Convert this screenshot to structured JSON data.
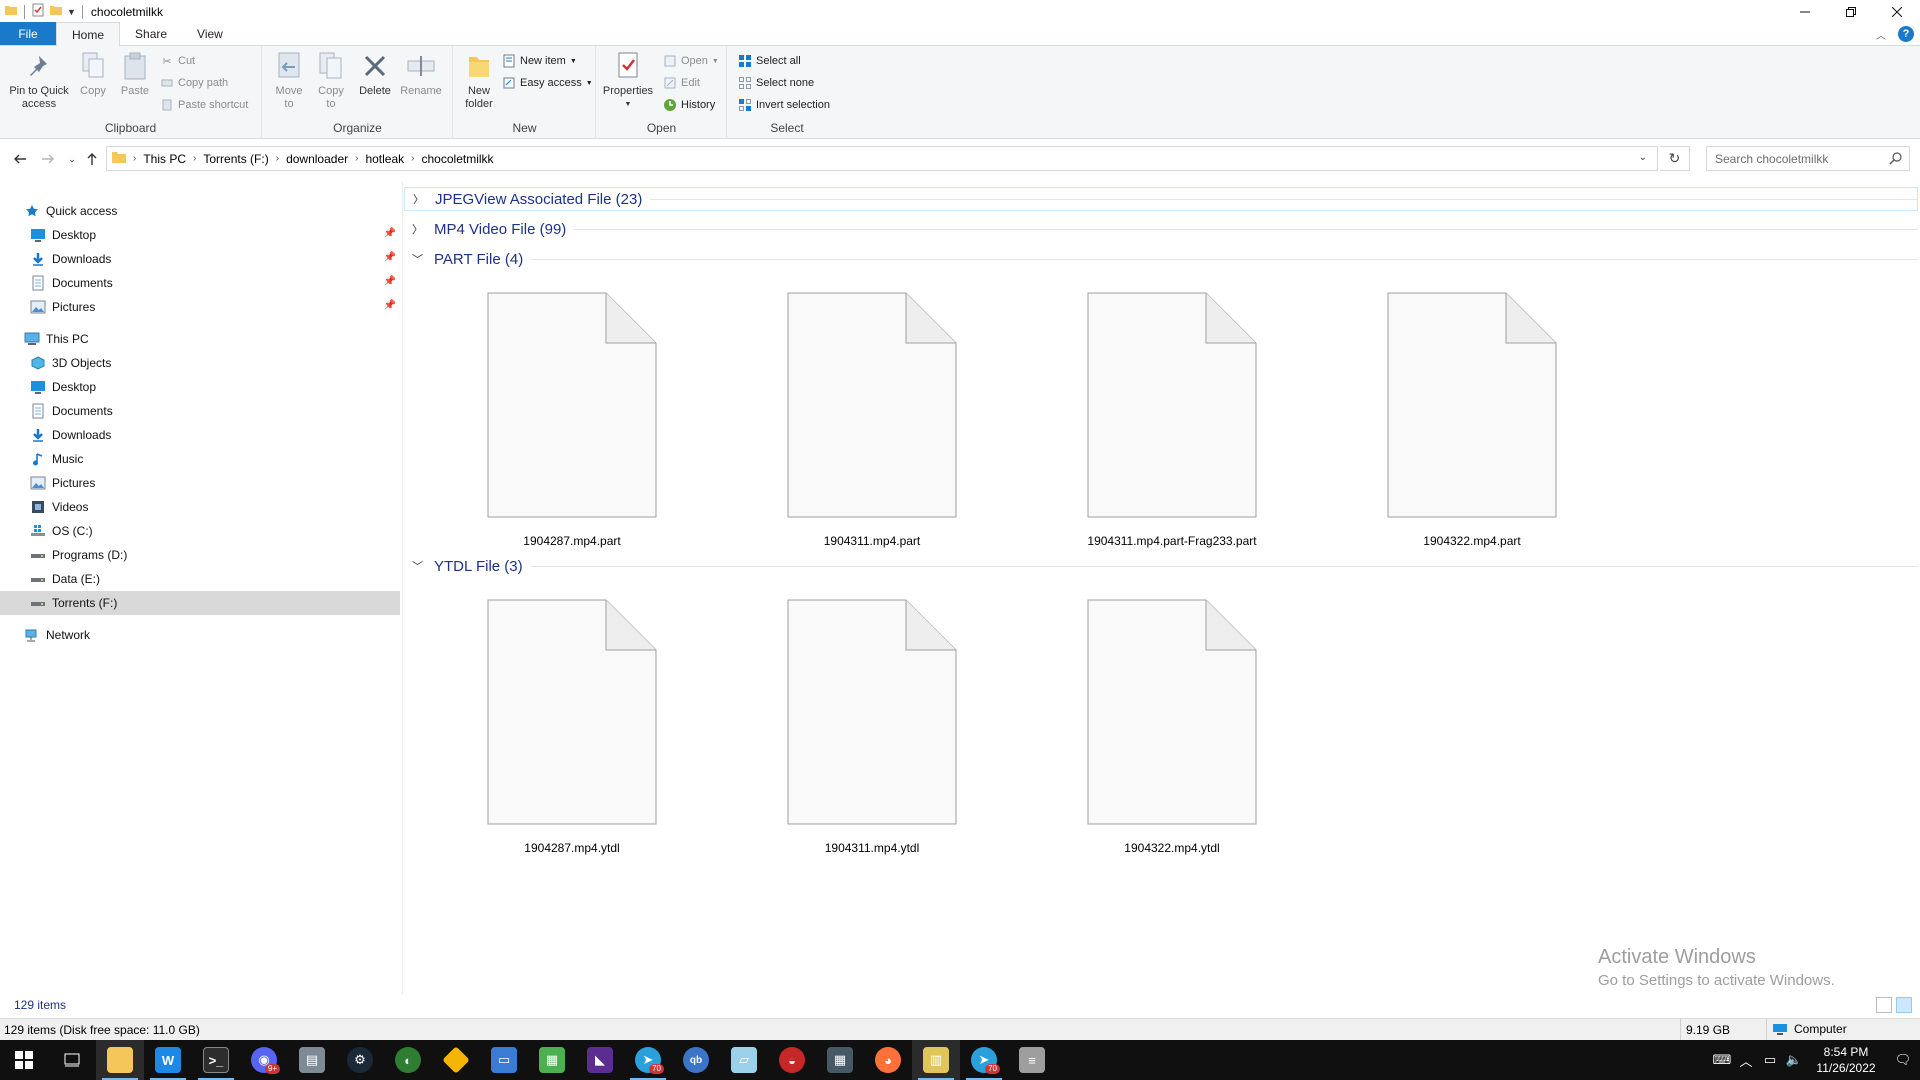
{
  "window": {
    "title": "chocoletmilkk"
  },
  "ribbon_tabs": {
    "file": "File",
    "home": "Home",
    "share": "Share",
    "view": "View"
  },
  "ribbon": {
    "clipboard": {
      "pin": "Pin to Quick access",
      "copy": "Copy",
      "paste": "Paste",
      "cut": "Cut",
      "copy_path": "Copy path",
      "paste_shortcut": "Paste shortcut",
      "label": "Clipboard"
    },
    "organize": {
      "move_to": "Move to",
      "copy_to": "Copy to",
      "delete": "Delete",
      "rename": "Rename",
      "label": "Organize"
    },
    "new": {
      "new_folder": "New folder",
      "new_item": "New item",
      "easy_access": "Easy access",
      "label": "New"
    },
    "open": {
      "properties": "Properties",
      "open": "Open",
      "edit": "Edit",
      "history": "History",
      "label": "Open"
    },
    "select": {
      "select_all": "Select all",
      "select_none": "Select none",
      "invert_selection": "Invert selection",
      "label": "Select"
    }
  },
  "address": {
    "crumbs": [
      "This PC",
      "Torrents (F:)",
      "downloader",
      "hotleak",
      "chocoletmilkk"
    ],
    "search_placeholder": "Search chocoletmilkk"
  },
  "nav": {
    "quick_access": "Quick access",
    "quick_items": [
      "Desktop",
      "Downloads",
      "Documents",
      "Pictures"
    ],
    "this_pc": "This PC",
    "pc_items": [
      "3D Objects",
      "Desktop",
      "Documents",
      "Downloads",
      "Music",
      "Pictures",
      "Videos",
      "OS (C:)",
      "Programs (D:)",
      "Data (E:)",
      "Torrents (F:)"
    ],
    "network": "Network"
  },
  "groups": [
    {
      "name": "JPEGView Associated File (23)",
      "expanded": false
    },
    {
      "name": "MP4 Video File (99)",
      "expanded": false
    },
    {
      "name": "PART File (4)",
      "expanded": true
    },
    {
      "name": "YTDL File (3)",
      "expanded": true
    }
  ],
  "part_files": [
    "1904287.mp4.part",
    "1904311.mp4.part",
    "1904311.mp4.part-Frag233.part",
    "1904322.mp4.part"
  ],
  "ytdl_files": [
    "1904287.mp4.ytdl",
    "1904311.mp4.ytdl",
    "1904322.mp4.ytdl"
  ],
  "watermark": {
    "line1": "Activate Windows",
    "line2": "Go to Settings to activate Windows."
  },
  "status": {
    "items": "129 items",
    "details": "129 items (Disk free space: 11.0 GB)",
    "size": "9.19 GB",
    "location": "Computer"
  },
  "taskbar": {
    "time": "8:54 PM",
    "date": "11/26/2022",
    "badges": [
      "9+",
      "70",
      "70"
    ]
  },
  "colors": {
    "accent": "#1979ca",
    "group_header": "#1e3287",
    "selection": "#d9d9d9",
    "taskbar": "#101010"
  }
}
